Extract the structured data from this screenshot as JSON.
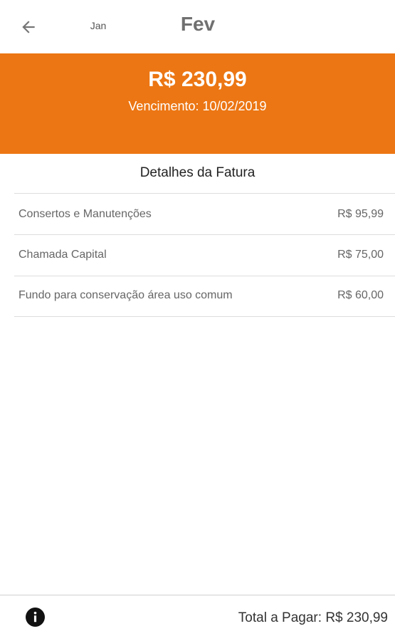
{
  "header": {
    "back_icon": "arrow-left-icon",
    "prev_month": "Jan",
    "current_month": "Fev"
  },
  "summary": {
    "amount": "R$ 230,99",
    "due_label": "Vencimento: 10/02/2019",
    "background_color": "#ec7613"
  },
  "details": {
    "title": "Detalhes da Fatura",
    "items": [
      {
        "description": "Consertos e Manutenções",
        "value": "R$ 95,99"
      },
      {
        "description": "Chamada Capital",
        "value": "R$ 75,00"
      },
      {
        "description": "Fundo para conservação área uso comum",
        "value": "R$ 60,00"
      }
    ]
  },
  "footer": {
    "info_icon": "info-icon",
    "total_label": "Total a Pagar: R$  230,99"
  }
}
